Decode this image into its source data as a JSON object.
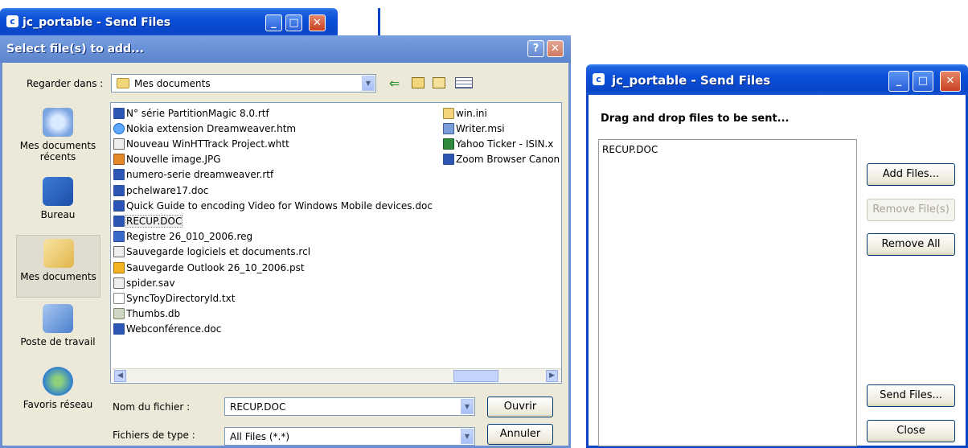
{
  "back_window": {
    "title": "jc_portable - Send Files"
  },
  "dialog": {
    "title": "Select file(s) to add...",
    "lookin_label": "Regarder dans :",
    "lookin_value": "Mes documents",
    "places": [
      {
        "label": "Mes documents récents",
        "icon": "recent-documents-icon"
      },
      {
        "label": "Bureau",
        "icon": "desktop-icon"
      },
      {
        "label": "Mes documents",
        "icon": "my-documents-icon"
      },
      {
        "label": "Poste de travail",
        "icon": "my-computer-icon"
      },
      {
        "label": "Favoris réseau",
        "icon": "network-icon"
      }
    ],
    "files_col1": [
      {
        "name": "N° série PartitionMagic 8.0.rtf",
        "icon": "word"
      },
      {
        "name": "Nokia extension Dreamweaver.htm",
        "icon": "ie"
      },
      {
        "name": "Nouveau WinHTTrack Project.whtt",
        "icon": "gen"
      },
      {
        "name": "Nouvelle image.JPG",
        "icon": "img"
      },
      {
        "name": "numero-serie dreamweaver.rtf",
        "icon": "word"
      },
      {
        "name": "pchelware17.doc",
        "icon": "word"
      },
      {
        "name": "Quick Guide to encoding Video for Windows Mobile devices.doc",
        "icon": "word"
      },
      {
        "name": "RECUP.DOC",
        "icon": "word"
      },
      {
        "name": "Registre 26_010_2006.reg",
        "icon": "reg"
      },
      {
        "name": "Sauvegarde logiciels et documents.rcl",
        "icon": "gen"
      },
      {
        "name": "Sauvegarde Outlook 26_10_2006.pst",
        "icon": "pst"
      },
      {
        "name": "spider.sav",
        "icon": "gen"
      },
      {
        "name": "SyncToyDirectoryId.txt",
        "icon": "txt"
      },
      {
        "name": "Thumbs.db",
        "icon": "db"
      },
      {
        "name": "Webconférence.doc",
        "icon": "word"
      }
    ],
    "files_col2": [
      {
        "name": "win.ini",
        "icon": "ini"
      },
      {
        "name": "Writer.msi",
        "icon": "msi"
      },
      {
        "name": "Yahoo Ticker - ISIN.x",
        "icon": "xl"
      },
      {
        "name": "Zoom Browser Canon",
        "icon": "word"
      }
    ],
    "filename_label": "Nom du fichier :",
    "filename_value": "RECUP.DOC",
    "filetype_label": "Fichiers de type :",
    "filetype_value": "All Files (*.*)",
    "open_button": "Ouvrir",
    "cancel_button": "Annuler"
  },
  "send_window": {
    "title": "jc_portable - Send Files",
    "heading": "Drag and drop files to be sent...",
    "files": [
      "RECUP.DOC"
    ],
    "add_button": "Add Files...",
    "remove_button": "Remove File(s)",
    "remove_all_button": "Remove All",
    "send_button": "Send Files...",
    "close_button": "Close"
  }
}
